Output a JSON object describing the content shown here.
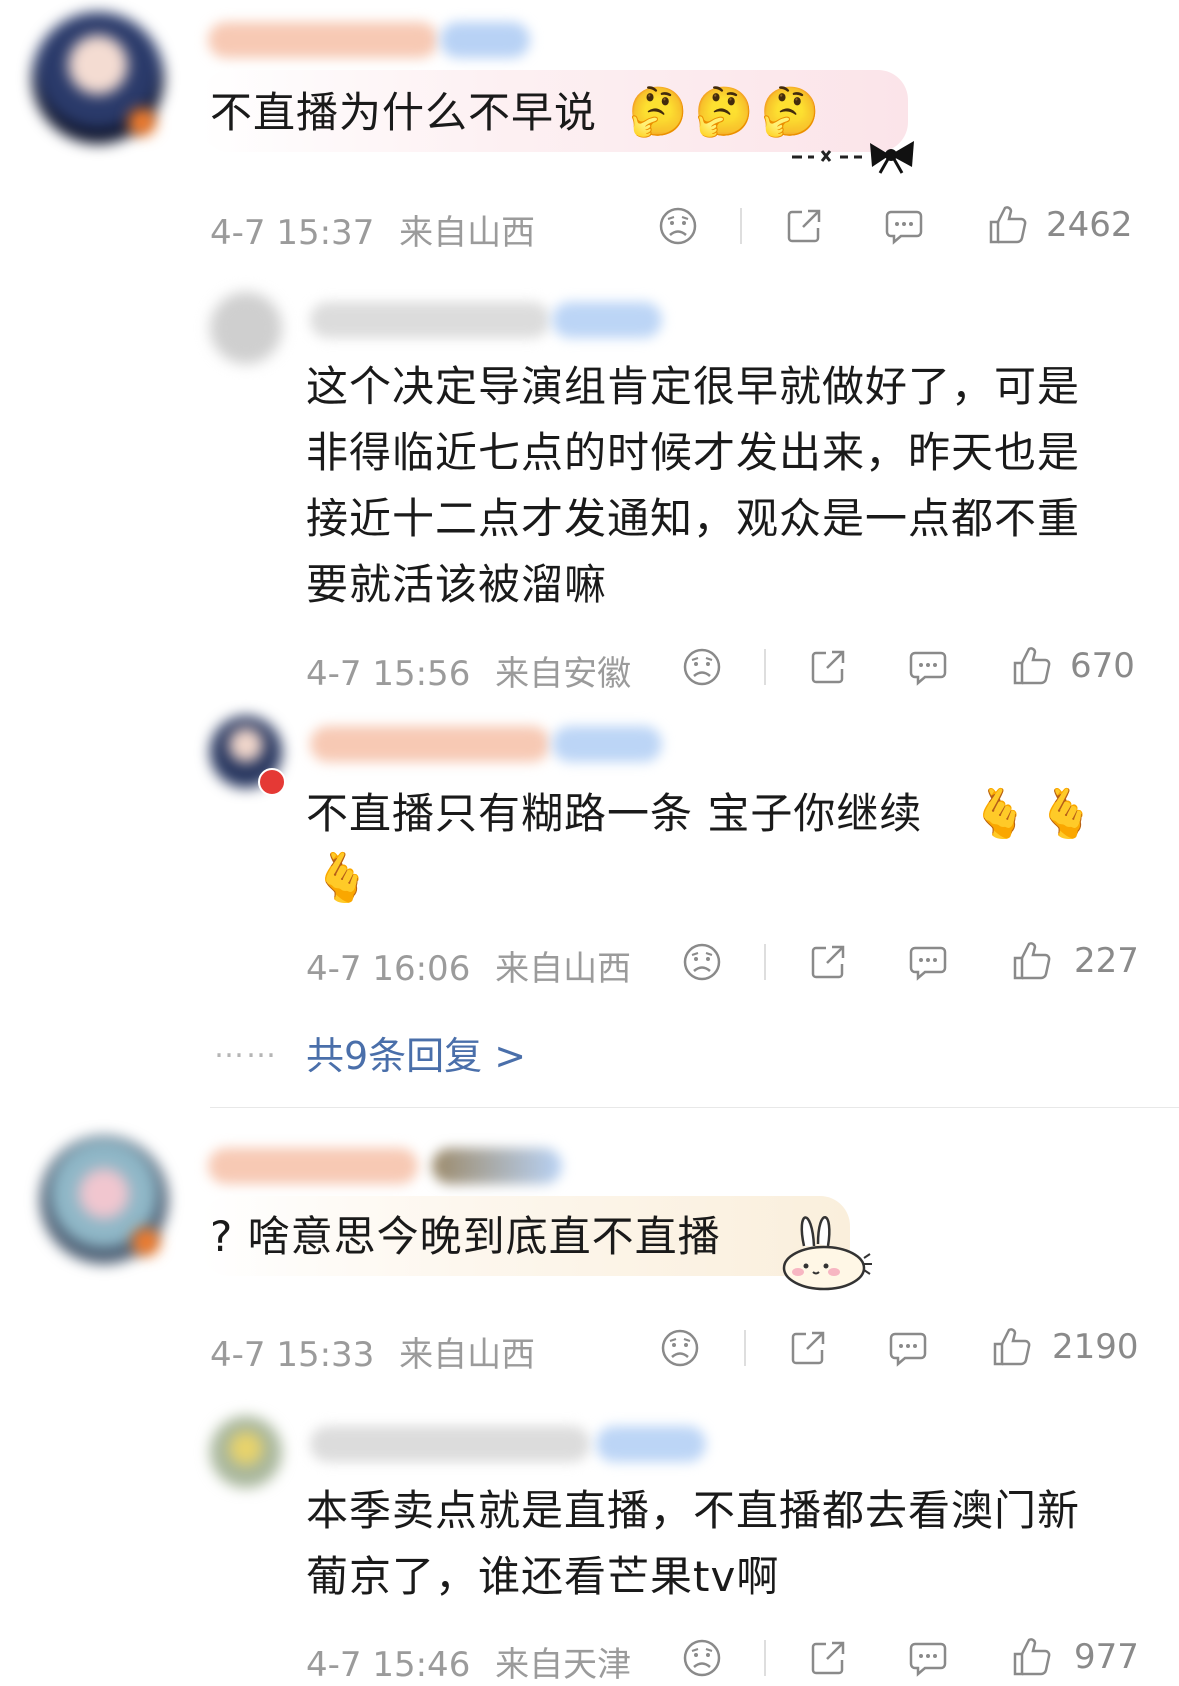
{
  "comments": [
    {
      "text": "不直播为什么不早说",
      "emojis": [
        "🤔",
        "🤔",
        "🤔"
      ],
      "time": "4-7 15:37",
      "location": "来自山西",
      "likes": "2462"
    },
    {
      "text": "?  啥意思今晚到底直不直播",
      "time": "4-7 15:33",
      "location": "来自山西",
      "likes": "2190"
    }
  ],
  "replies": [
    {
      "lines": [
        "这个决定导演组肯定很早就做好了，可是",
        "非得临近七点的时候才发出来，昨天也是",
        "接近十二点才发通知，观众是一点都不重",
        "要就活该被溜嘛"
      ],
      "time": "4-7 15:56",
      "location": "来自安徽",
      "likes": "670"
    },
    {
      "lines": [
        "不直播只有糊路一条  宝子你继续"
      ],
      "emojis": [
        "🫰",
        "🫰",
        "🫰"
      ],
      "time": "4-7 16:06",
      "location": "来自山西",
      "likes": "227"
    },
    {
      "lines": [
        "本季卖点就是直播，不直播都去看澳门新",
        "葡京了，谁还看芒果tv啊"
      ],
      "time": "4-7 15:46",
      "location": "来自天津",
      "likes": "977"
    }
  ],
  "more_replies": {
    "dots": "……",
    "label": "共9条回复 >"
  },
  "colors": {
    "link": "#4a6faa",
    "meta": "#9b9b9b",
    "bubble1": "#fbe9ec",
    "bubble2": "#fbf3e6"
  },
  "icons": [
    "sad-face-icon",
    "share-icon",
    "comment-icon",
    "thumbs-up-icon"
  ]
}
